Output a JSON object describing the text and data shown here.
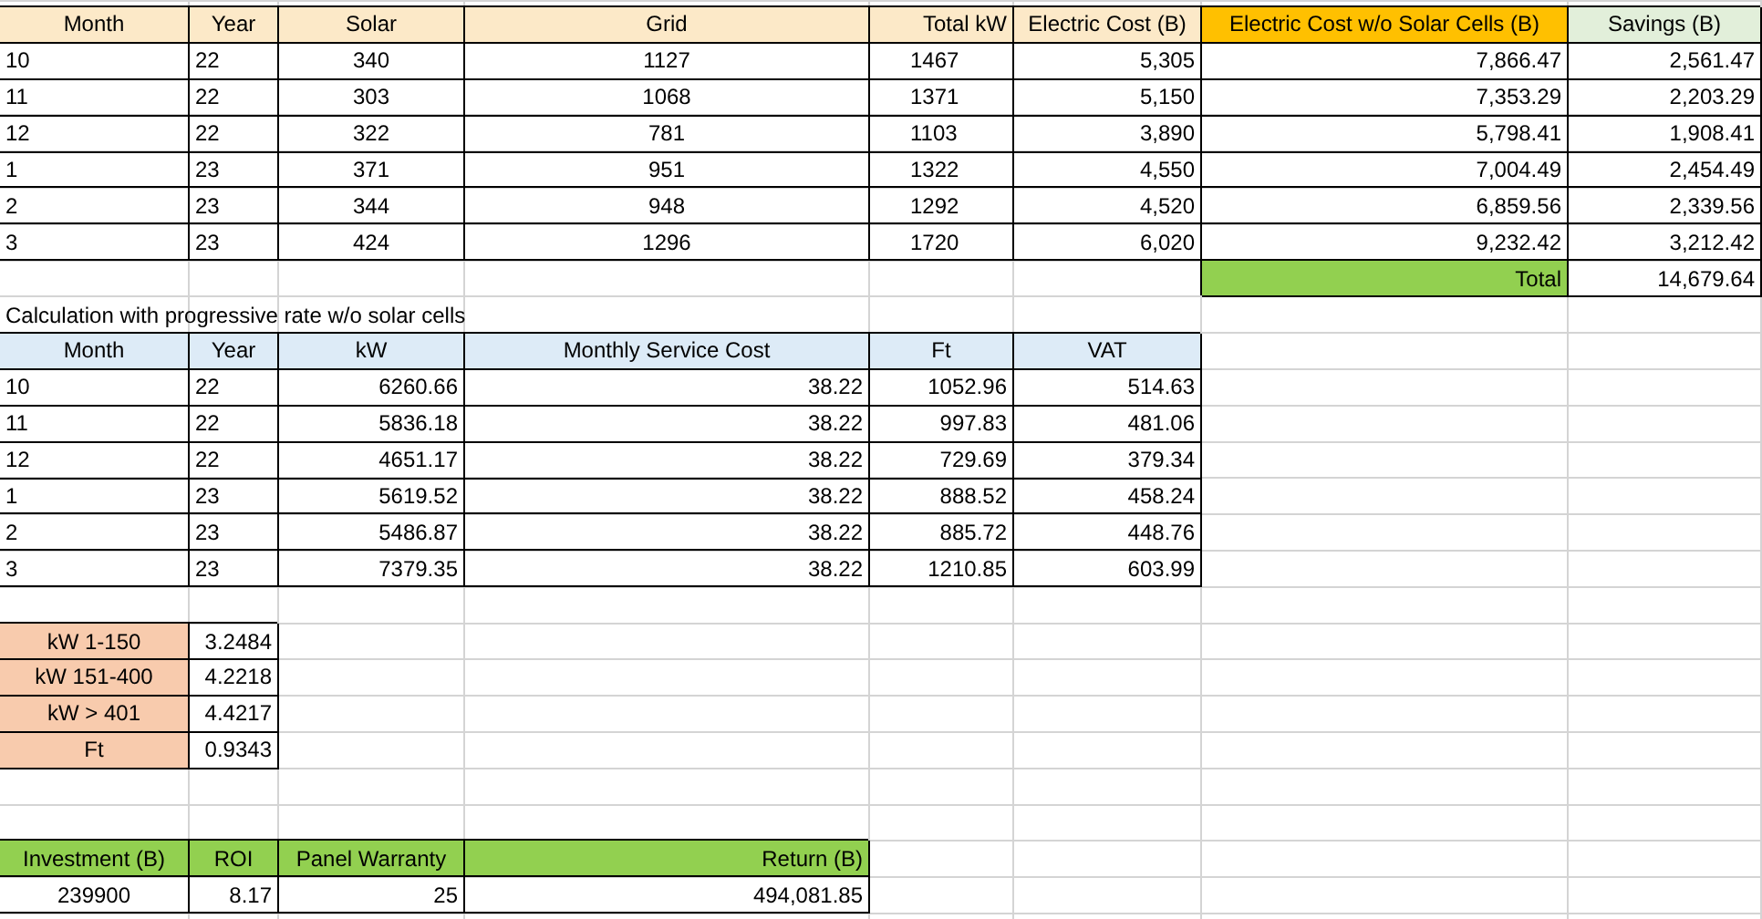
{
  "energy_table": {
    "columns": [
      {
        "label": "Month",
        "color": "#fce9c8"
      },
      {
        "label": "Year",
        "color": "#fce9c8"
      },
      {
        "label": "Solar",
        "color": "#fce9c8"
      },
      {
        "label": "Grid",
        "color": "#fce9c8"
      },
      {
        "label": "Total kW",
        "color": "#fce9c8"
      },
      {
        "label": "Electric Cost (B)",
        "color": "#fce9c8"
      },
      {
        "label": "Electric Cost w/o Solar Cells (B)",
        "color": "#ffc000"
      },
      {
        "label": "Savings (B)",
        "color": "#e2efda"
      }
    ],
    "rows": [
      [
        "10",
        "22",
        "340",
        "1127",
        "1467",
        "5,305",
        "7,866.47",
        "2,561.47"
      ],
      [
        "11",
        "22",
        "303",
        "1068",
        "1371",
        "5,150",
        "7,353.29",
        "2,203.29"
      ],
      [
        "12",
        "22",
        "322",
        "781",
        "1103",
        "3,890",
        "5,798.41",
        "1,908.41"
      ],
      [
        "1",
        "23",
        "371",
        "951",
        "1322",
        "4,550",
        "7,004.49",
        "2,454.49"
      ],
      [
        "2",
        "23",
        "344",
        "948",
        "1292",
        "4,520",
        "6,859.56",
        "2,339.56"
      ],
      [
        "3",
        "23",
        "424",
        "1296",
        "1720",
        "6,020",
        "9,232.42",
        "3,212.42"
      ]
    ],
    "total": {
      "label": "Total",
      "value": "14,679.64"
    }
  },
  "note": "Calculation with progressive rate w/o solar cells",
  "progressive_table": {
    "columns": [
      "Month",
      "Year",
      "kW",
      "Monthly Service Cost",
      "Ft",
      "VAT"
    ],
    "rows": [
      [
        "10",
        "22",
        "6260.66",
        "38.22",
        "1052.96",
        "514.63"
      ],
      [
        "11",
        "22",
        "5836.18",
        "38.22",
        "997.83",
        "481.06"
      ],
      [
        "12",
        "22",
        "4651.17",
        "38.22",
        "729.69",
        "379.34"
      ],
      [
        "1",
        "23",
        "5619.52",
        "38.22",
        "888.52",
        "458.24"
      ],
      [
        "2",
        "23",
        "5486.87",
        "38.22",
        "885.72",
        "448.76"
      ],
      [
        "3",
        "23",
        "7379.35",
        "38.22",
        "1210.85",
        "603.99"
      ]
    ]
  },
  "rates": [
    {
      "label": "kW 1-150",
      "value": "3.2484"
    },
    {
      "label": "kW 151-400",
      "value": "4.2218"
    },
    {
      "label": "kW > 401",
      "value": "4.4217"
    },
    {
      "label": "Ft",
      "value": "0.9343"
    }
  ],
  "investment": {
    "columns": [
      "Investment (B)",
      "ROI",
      "Panel Warranty",
      "Return (B)"
    ],
    "values": [
      "239900",
      "8.17",
      "25",
      "494,081.85"
    ]
  }
}
